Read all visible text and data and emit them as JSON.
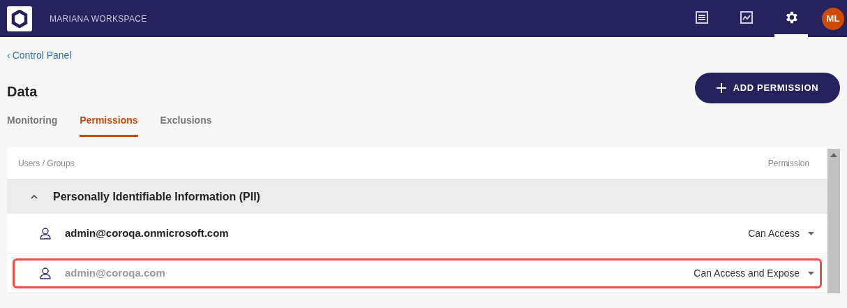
{
  "header": {
    "workspace": "MARIANA WORKSPACE",
    "nav": [
      {
        "kind": "list",
        "selected": false
      },
      {
        "kind": "chart",
        "selected": false
      },
      {
        "kind": "settings",
        "selected": true
      }
    ],
    "avatar": "ML"
  },
  "breadcrumb": {
    "chevron": "‹",
    "label": "Control Panel"
  },
  "page": {
    "title": "Data",
    "add_button": "ADD PERMISSION"
  },
  "tabs": [
    {
      "label": "Monitoring",
      "selected": false
    },
    {
      "label": "Permissions",
      "selected": true
    },
    {
      "label": "Exclusions",
      "selected": false
    }
  ],
  "table": {
    "columns": [
      "Users / Groups",
      "Permission"
    ],
    "groups": [
      {
        "name": "Personally Identifiable Information (PII)",
        "expanded": true,
        "rows": [
          {
            "user": "admin@coroqa.onmicrosoft.com",
            "permission": "Can Access",
            "highlighted": false
          },
          {
            "user": "admin@coroqa.com",
            "permission": "Can Access and Expose",
            "highlighted": true
          }
        ]
      }
    ]
  }
}
